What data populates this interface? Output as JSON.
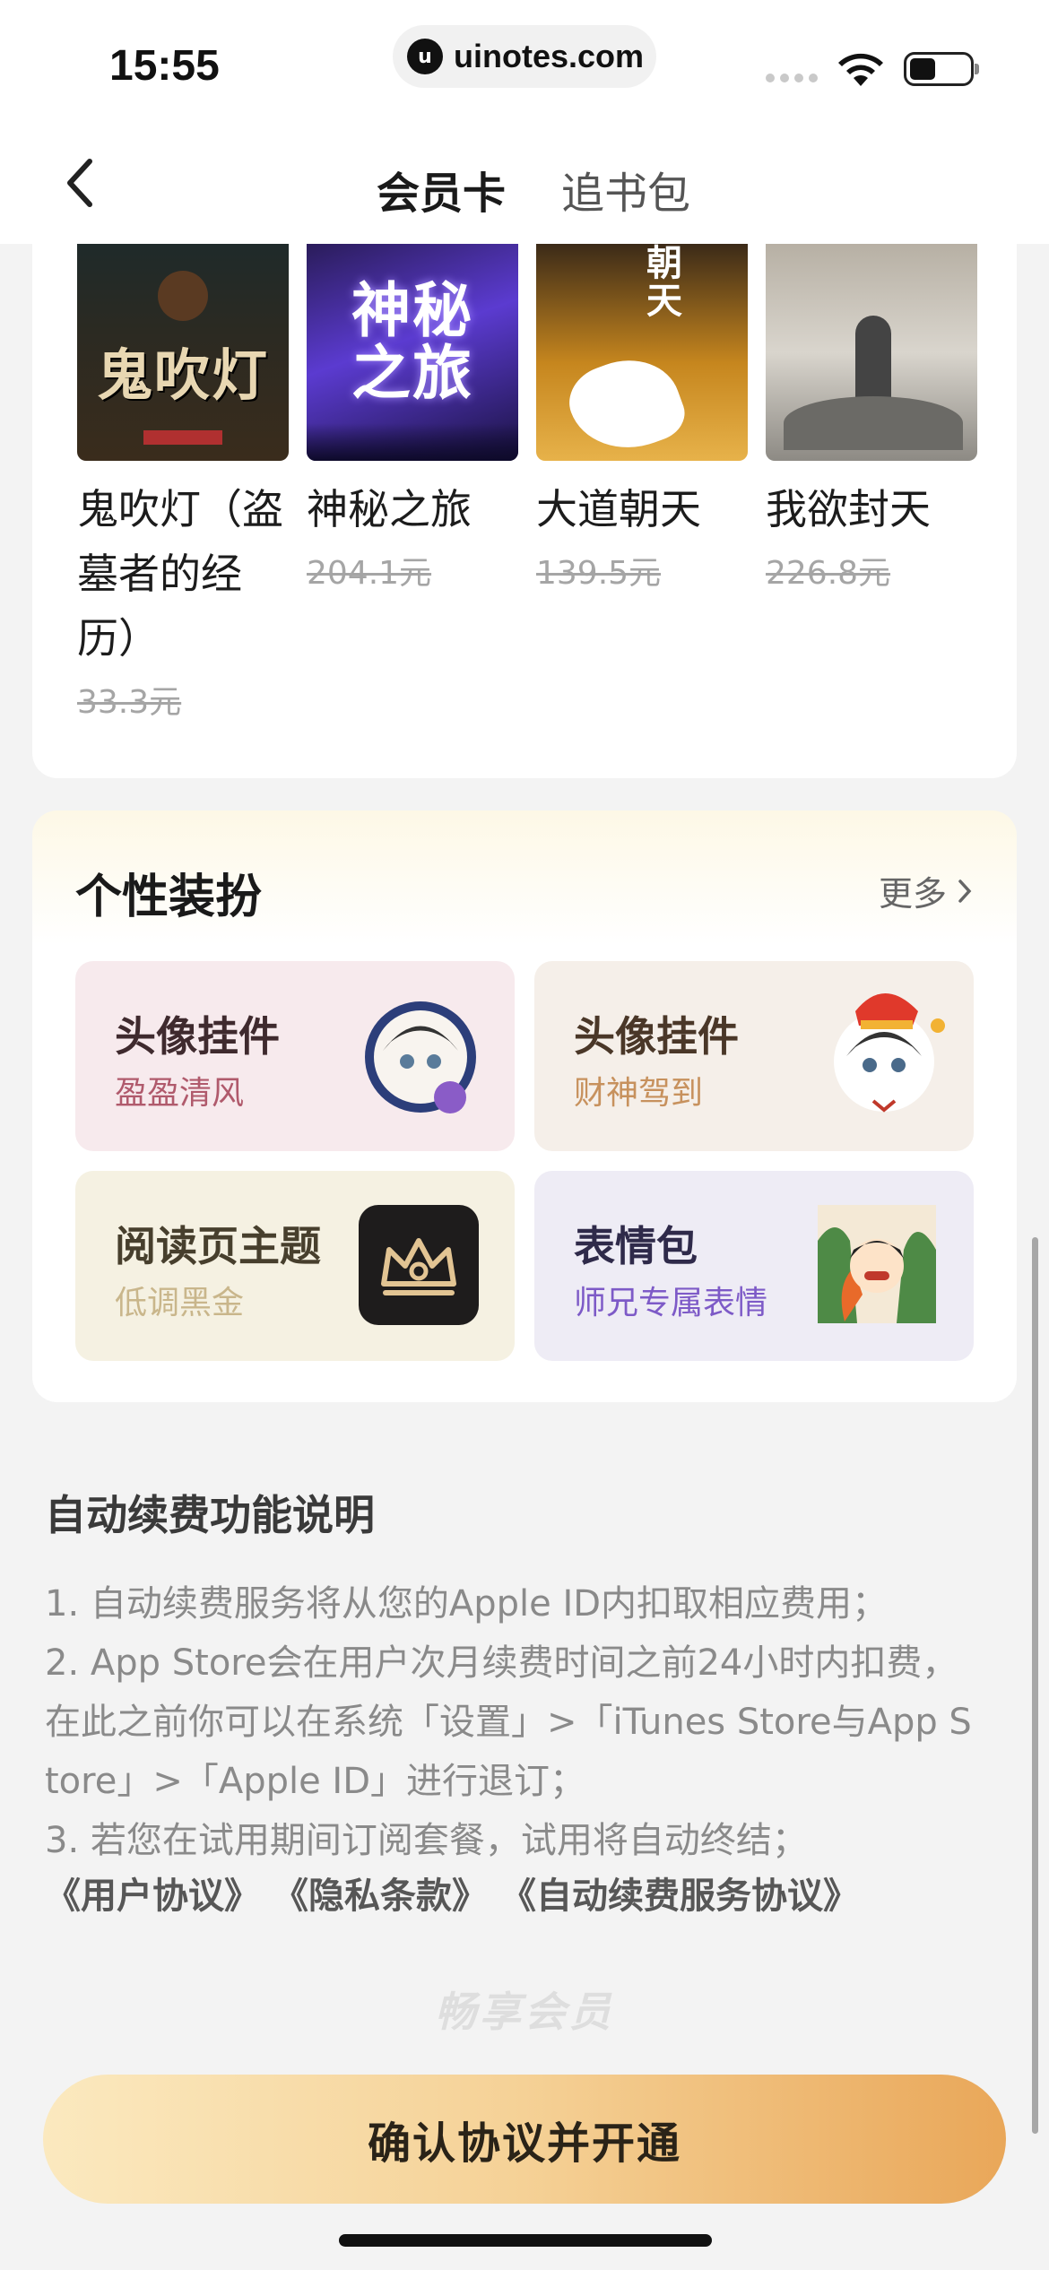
{
  "status_bar": {
    "time": "15:55",
    "url": "uinotes.com",
    "url_icon": "u"
  },
  "nav": {
    "tabs": [
      {
        "label": "会员卡",
        "active": true
      },
      {
        "label": "追书包",
        "active": false
      }
    ]
  },
  "books": [
    {
      "cover_text": "鬼吹灯",
      "name": "鬼吹灯（盗墓者的经历）",
      "price": "33.3元"
    },
    {
      "cover_text": "神秘之旅",
      "name": "神秘之旅",
      "price": "204.1元"
    },
    {
      "cover_text": "朝天",
      "name": "大道朝天",
      "price": "139.5元"
    },
    {
      "cover_text": "",
      "name": "我欲封天",
      "price": "226.8元"
    }
  ],
  "dress_up": {
    "title": "个性装扮",
    "more": "更多",
    "items": [
      {
        "title": "头像挂件",
        "subtitle": "盈盈清风",
        "icon": "avatar-pendant-icon"
      },
      {
        "title": "头像挂件",
        "subtitle": "财神驾到",
        "icon": "avatar-pendant-icon"
      },
      {
        "title": "阅读页主题",
        "subtitle": "低调黑金",
        "icon": "crown-icon"
      },
      {
        "title": "表情包",
        "subtitle": "师兄专属表情",
        "icon": "sticker-icon"
      }
    ]
  },
  "renew": {
    "title": "自动续费功能说明",
    "lines": [
      "1. 自动续费服务将从您的Apple ID内扣取相应费用；",
      "2. App Store会在用户次月续费时间之前24小时内扣费，",
      "在此之前你可以在系统「设置」>「iTunes Store与App S",
      "tore」>「Apple ID」进行退订；",
      "3. 若您在试用期间订阅套餐，试用将自动终结；"
    ],
    "agreements": [
      "《用户协议》",
      "《隐私条款》",
      "《自动续费服务协议》"
    ]
  },
  "watermark": "畅享会员",
  "confirm_button": "确认协议并开通",
  "colors": {
    "button_start": "#fbe9bf",
    "button_end": "#e9a759",
    "background": "#f3f3f3"
  }
}
